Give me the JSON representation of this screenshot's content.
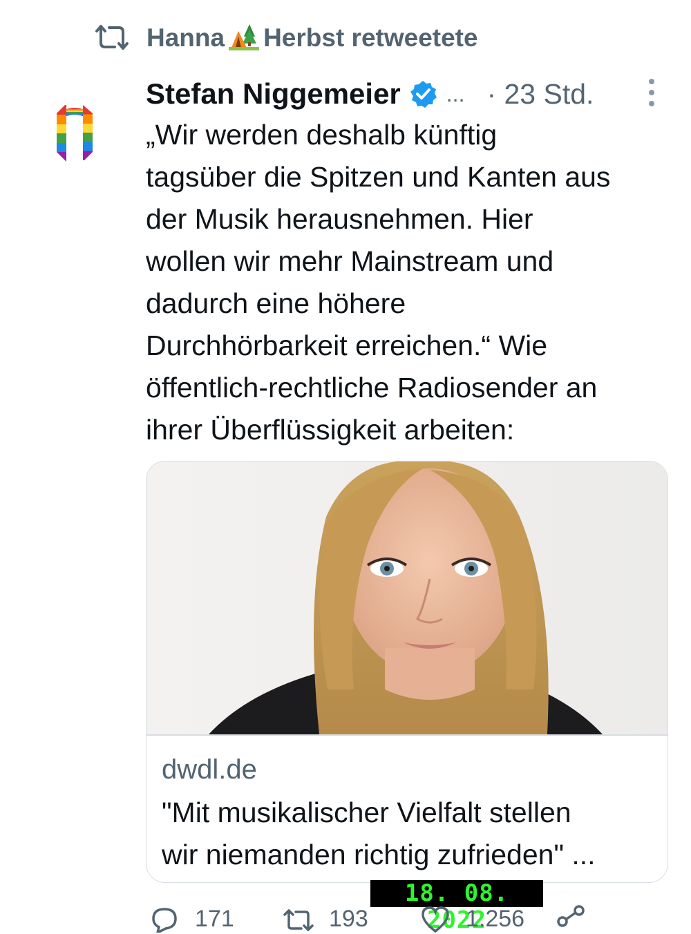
{
  "retweet": {
    "icon": "retweet-icon",
    "name_part1": "Hanna",
    "emoji": "camping-emoji",
    "name_part2": "Herbst retweetete"
  },
  "tweet": {
    "author": "Stefan Niggemeier",
    "verified_icon": "verified-badge-icon",
    "handle_truncated": "...",
    "time": "· 23 Std.",
    "text": "„Wir werden deshalb künftig\ntagsüber die Spitzen und Kanten aus\nder Musik herausnehmen. Hier\nwollen wir mehr Mainstream und\ndadurch eine höhere\nDurchhörbarkeit erreichen.“ Wie\nöffentlich-rechtliche Radiosender an\nihrer Überflüssigkeit arbeiten:"
  },
  "card": {
    "domain": "dwdl.de",
    "title": "\"Mit musikalischer Vielfalt stellen\nwir niemanden richtig zufrieden\" ..."
  },
  "actions": {
    "replies": "171",
    "retweets": "193",
    "likes": "1.256"
  },
  "date_stamp": "18. 08. 2022",
  "colors": {
    "secondary_text": "#536471",
    "verified_blue": "#1d9bf0",
    "stamp_green": "#2df52d"
  }
}
